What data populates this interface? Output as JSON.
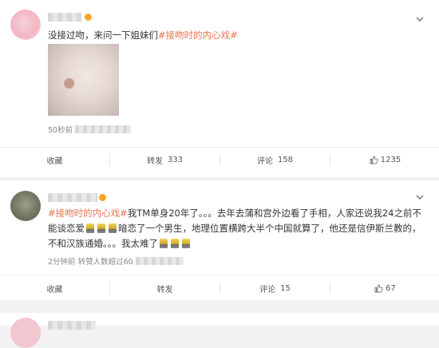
{
  "posts": [
    {
      "text_plain": "没接过吻，来问一下姐妹们",
      "hashtag": "#接吻时的内心戏#",
      "time": "50秒前",
      "actions": {
        "collect": "收藏",
        "repost_label": "转发",
        "repost_count": "333",
        "comment_label": "评论",
        "comment_count": "158",
        "like_count": "1235"
      }
    },
    {
      "hashtag": "#接吻时的内心戏#",
      "line1_rest": "我TM单身20年了。。。去年去蒲和宫外边看了手相，人家还说我24之前不",
      "line2_a": "能谈恋爱",
      "line2_b": "暗恋了一个男生，地理位置横跨大半个中国就算了，他还是信伊斯兰教的，",
      "line3": "不和汉族通婚。。。我太难了",
      "time": "2分钟前 转赞人数超过60",
      "actions": {
        "collect": "收藏",
        "repost_label": "转发",
        "comment_label": "评论",
        "comment_count": "15",
        "like_count": "67"
      }
    }
  ],
  "colors": {
    "hashtag": "#eb7350",
    "text": "#333333",
    "meta": "#888888"
  }
}
